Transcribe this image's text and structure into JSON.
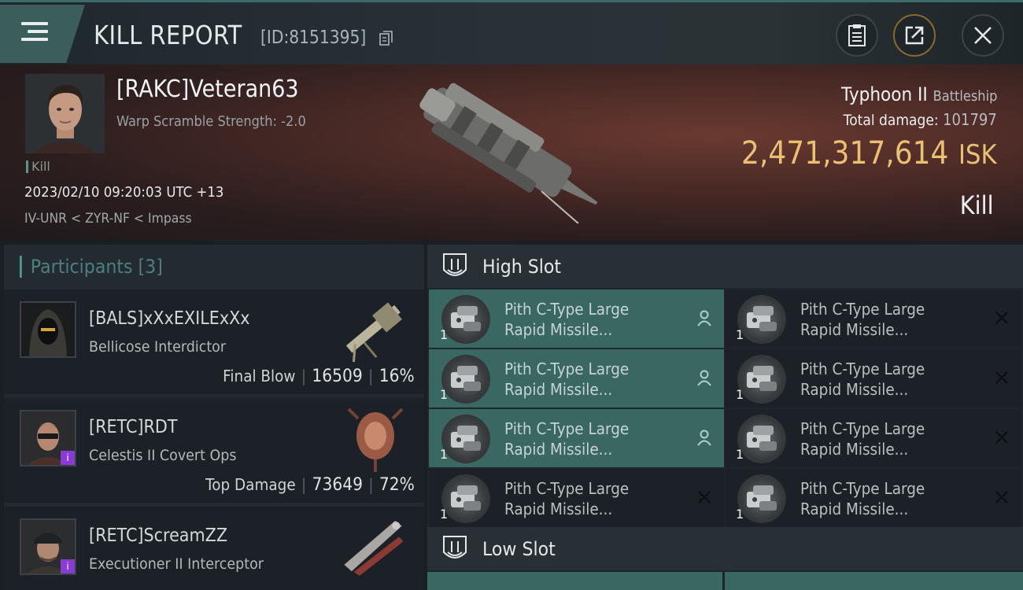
{
  "header": {
    "title": "KILL REPORT",
    "report_id": "[ID:8151395]"
  },
  "victim": {
    "name": "[RAKC]Veteran63",
    "subtitle": "Warp Scramble Strength: -2.0",
    "tag": "Kill",
    "timestamp": "2023/02/10 09:20:03 UTC +13",
    "location": "IV-UNR < ZYR-NF < Impass",
    "ship_name": "Typhoon II",
    "ship_class": "Battleship",
    "total_damage_label": "Total damage:",
    "total_damage": "101797",
    "isk_value": "2,471,317,614",
    "isk_unit": "ISK",
    "result": "Kill"
  },
  "participants": {
    "heading": "Participants",
    "count": "[3]",
    "rows": [
      {
        "name": "[BALS]xXxEXILExXx",
        "ship": "Bellicose Interdictor",
        "role": "Final Blow",
        "damage": "16509",
        "percent": "16%"
      },
      {
        "name": "[RETC]RDT",
        "ship": "Celestis II Covert Ops",
        "role": "Top Damage",
        "damage": "73649",
        "percent": "72%"
      },
      {
        "name": "[RETC]ScreamZZ",
        "ship": "Executioner II Interceptor",
        "role": "",
        "damage": "",
        "percent": ""
      }
    ]
  },
  "fittings": {
    "high_slot_label": "High Slot",
    "low_slot_label": "Low Slot",
    "high_slot": [
      {
        "name_line1": "Pith C-Type Large",
        "name_line2": "Rapid Missile...",
        "qty": "1",
        "status": "pilot"
      },
      {
        "name_line1": "Pith C-Type Large",
        "name_line2": "Rapid Missile...",
        "qty": "1",
        "status": "destroyed"
      },
      {
        "name_line1": "Pith C-Type Large",
        "name_line2": "Rapid Missile...",
        "qty": "1",
        "status": "pilot"
      },
      {
        "name_line1": "Pith C-Type Large",
        "name_line2": "Rapid Missile...",
        "qty": "1",
        "status": "destroyed"
      },
      {
        "name_line1": "Pith C-Type Large",
        "name_line2": "Rapid Missile...",
        "qty": "1",
        "status": "pilot"
      },
      {
        "name_line1": "Pith C-Type Large",
        "name_line2": "Rapid Missile...",
        "qty": "1",
        "status": "destroyed"
      },
      {
        "name_line1": "Pith C-Type Large",
        "name_line2": "Rapid Missile...",
        "qty": "1",
        "status": "destroyed"
      },
      {
        "name_line1": "Pith C-Type Large",
        "name_line2": "Rapid Missile...",
        "qty": "1",
        "status": "destroyed"
      }
    ]
  },
  "colors": {
    "accent_teal": "#3b6763",
    "isk_gold": "#e9c074",
    "badge_purple": "#8a3bd6"
  }
}
